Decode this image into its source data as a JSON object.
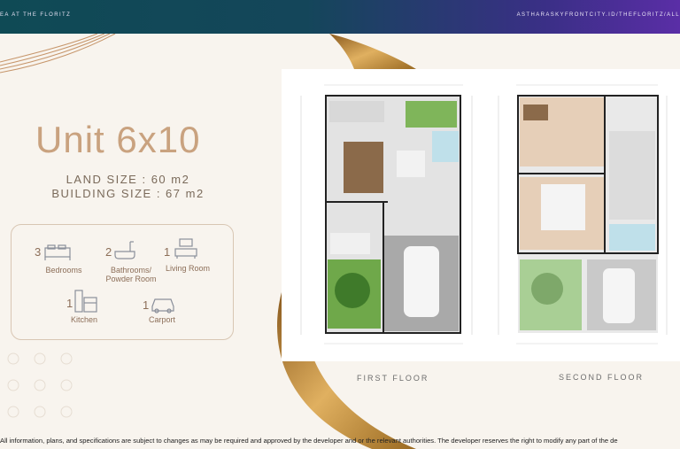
{
  "header": {
    "left_text": "EA AT THE FLORITZ",
    "right_text": "ASTHARASKYFRONTCITY.ID/THEFLORITZ/ALL"
  },
  "unit": {
    "title": "Unit 6x10",
    "land_size": "LAND SIZE : 60 m2",
    "building_size": "BUILDING SIZE : 67 m2"
  },
  "amenities": [
    {
      "count": "3",
      "label": "Bedrooms",
      "icon": "bed-icon"
    },
    {
      "count": "2",
      "label": "Bathrooms/ Powder Room",
      "icon": "bathtub-icon"
    },
    {
      "count": "1",
      "label": "Living Room",
      "icon": "sofa-icon"
    },
    {
      "count": "1",
      "label": "Kitchen",
      "icon": "kitchen-icon"
    },
    {
      "count": "1",
      "label": "Carport",
      "icon": "car-icon"
    }
  ],
  "floors": {
    "first": "FIRST FLOOR",
    "second": "SECOND FLOOR"
  },
  "footer": "All information, plans, and specifications are subject to changes as may be required and approved by the developer and or the relevant authorities. The developer reserves the right to modify any part of the de",
  "colors": {
    "accent": "#c9a27f",
    "gold": "#c8922e",
    "header_start": "#0f4a55",
    "header_end": "#5a2ea6"
  }
}
